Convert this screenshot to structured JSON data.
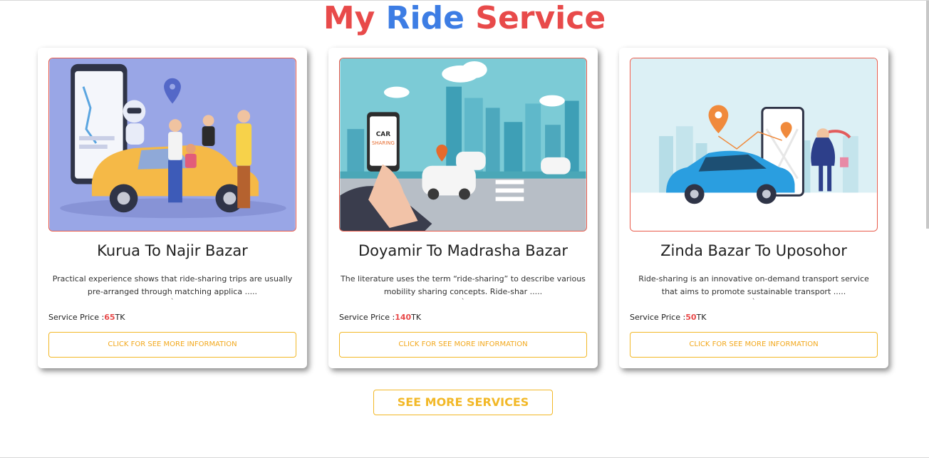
{
  "header": {
    "title_part1": "My",
    "title_part2": "Ride",
    "title_part3": "Service"
  },
  "colors": {
    "accent_red": "#e84a4a",
    "accent_blue": "#3d7de4",
    "button_yellow": "#f2b827"
  },
  "cards": [
    {
      "title": "Kurua To Najir Bazar",
      "description": "Practical experience shows that ride-sharing trips are usually pre-arranged through matching applica .....",
      "tick": "`",
      "price_label": "Service Price :",
      "price_value": "65",
      "price_unit": "TK",
      "button_label": "CLICK FOR SEE MORE INFORMATION",
      "image_icon": "ride-sharing-illustration"
    },
    {
      "title": "Doyamir To Madrasha Bazar",
      "description": "The literature uses the term “ride-sharing” to describe various mobility sharing concepts. Ride-shar .....",
      "tick": "`",
      "price_label": "Service Price :",
      "price_value": "140",
      "price_unit": "TK",
      "button_label": "CLICK FOR SEE MORE INFORMATION",
      "image_icon": "car-sharing-city-illustration",
      "image_text": "CAR SHARING"
    },
    {
      "title": "Zinda Bazar To Uposohor",
      "description": "Ride-sharing is an innovative on-demand transport service that aims to promote sustainable transport .....",
      "tick": "`",
      "price_label": "Service Price :",
      "price_value": "50",
      "price_unit": "TK",
      "button_label": "CLICK FOR SEE MORE INFORMATION",
      "image_icon": "taxi-app-illustration"
    }
  ],
  "footer": {
    "see_more_label": "SEE MORE SERVICES"
  }
}
